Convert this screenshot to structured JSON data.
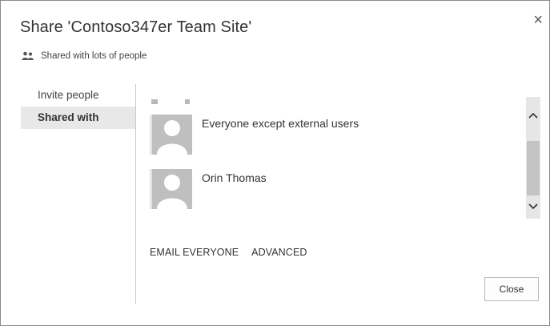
{
  "dialog": {
    "title": "Share 'Contoso347er Team Site'",
    "close_glyph": "×",
    "subtitle": "Shared with lots of people",
    "subtitle_icon": "people-icon"
  },
  "nav": {
    "items": [
      {
        "label": "Invite people",
        "selected": false
      },
      {
        "label": "Shared with",
        "selected": true
      }
    ]
  },
  "people": [
    {
      "name": "Everyone except external users",
      "icon": "default-user-avatar-icon"
    },
    {
      "name": "Orin Thomas",
      "icon": "default-user-avatar-icon"
    }
  ],
  "scrollbar": {
    "up_glyph": "^",
    "down_glyph": "v"
  },
  "actions": {
    "email_everyone": "EMAIL EVERYONE",
    "advanced": "ADVANCED"
  },
  "footer": {
    "close_label": "Close"
  }
}
